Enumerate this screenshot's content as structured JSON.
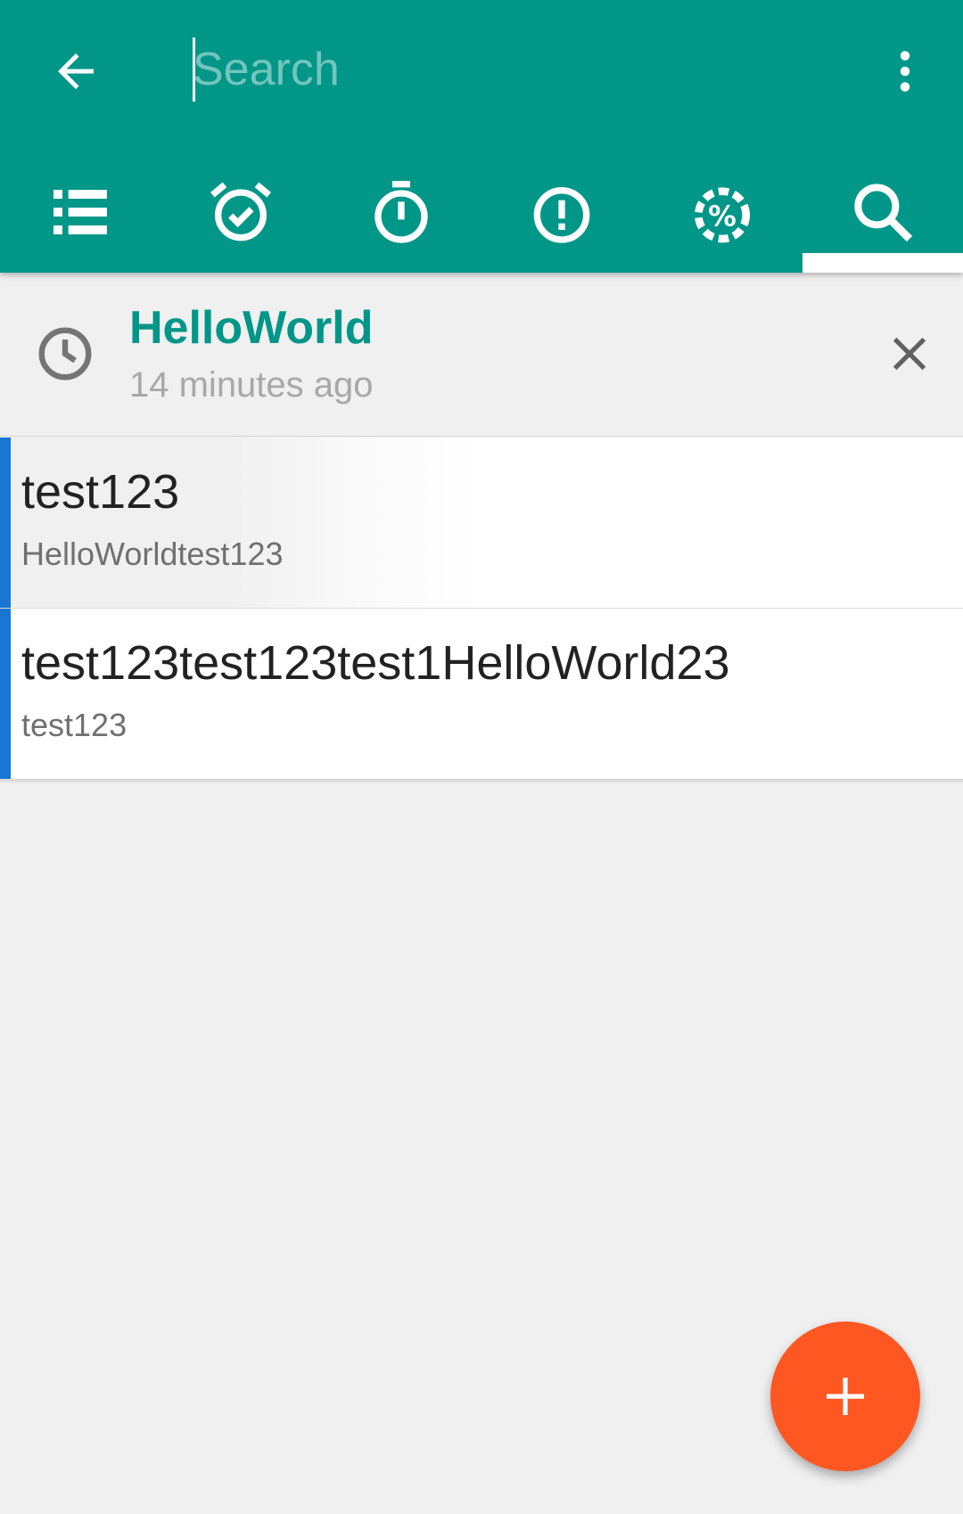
{
  "appbar": {
    "background_color": "#009688",
    "back_icon": "arrow-left-icon",
    "more_icon": "more-vertical-icon"
  },
  "search": {
    "placeholder": "Search",
    "value": ""
  },
  "tabs": [
    {
      "icon": "list-icon",
      "selected": false
    },
    {
      "icon": "alarm-check-icon",
      "selected": false
    },
    {
      "icon": "timer-icon",
      "selected": false
    },
    {
      "icon": "alert-circle-icon",
      "selected": false
    },
    {
      "icon": "progress-percent-icon",
      "selected": false
    },
    {
      "icon": "search-icon",
      "selected": true
    }
  ],
  "history": {
    "icon": "clock-icon",
    "query": "HelloWorld",
    "time": "14 minutes ago",
    "close_icon": "close-icon"
  },
  "notes": [
    {
      "title": "test123",
      "subtitle": "HelloWorldtest123",
      "color": "#1976d2"
    },
    {
      "title": "test123test123test1HelloWorld23",
      "subtitle": "test123",
      "color": "#1976d2"
    }
  ],
  "fab": {
    "icon": "plus-icon",
    "color": "#ff5722"
  }
}
